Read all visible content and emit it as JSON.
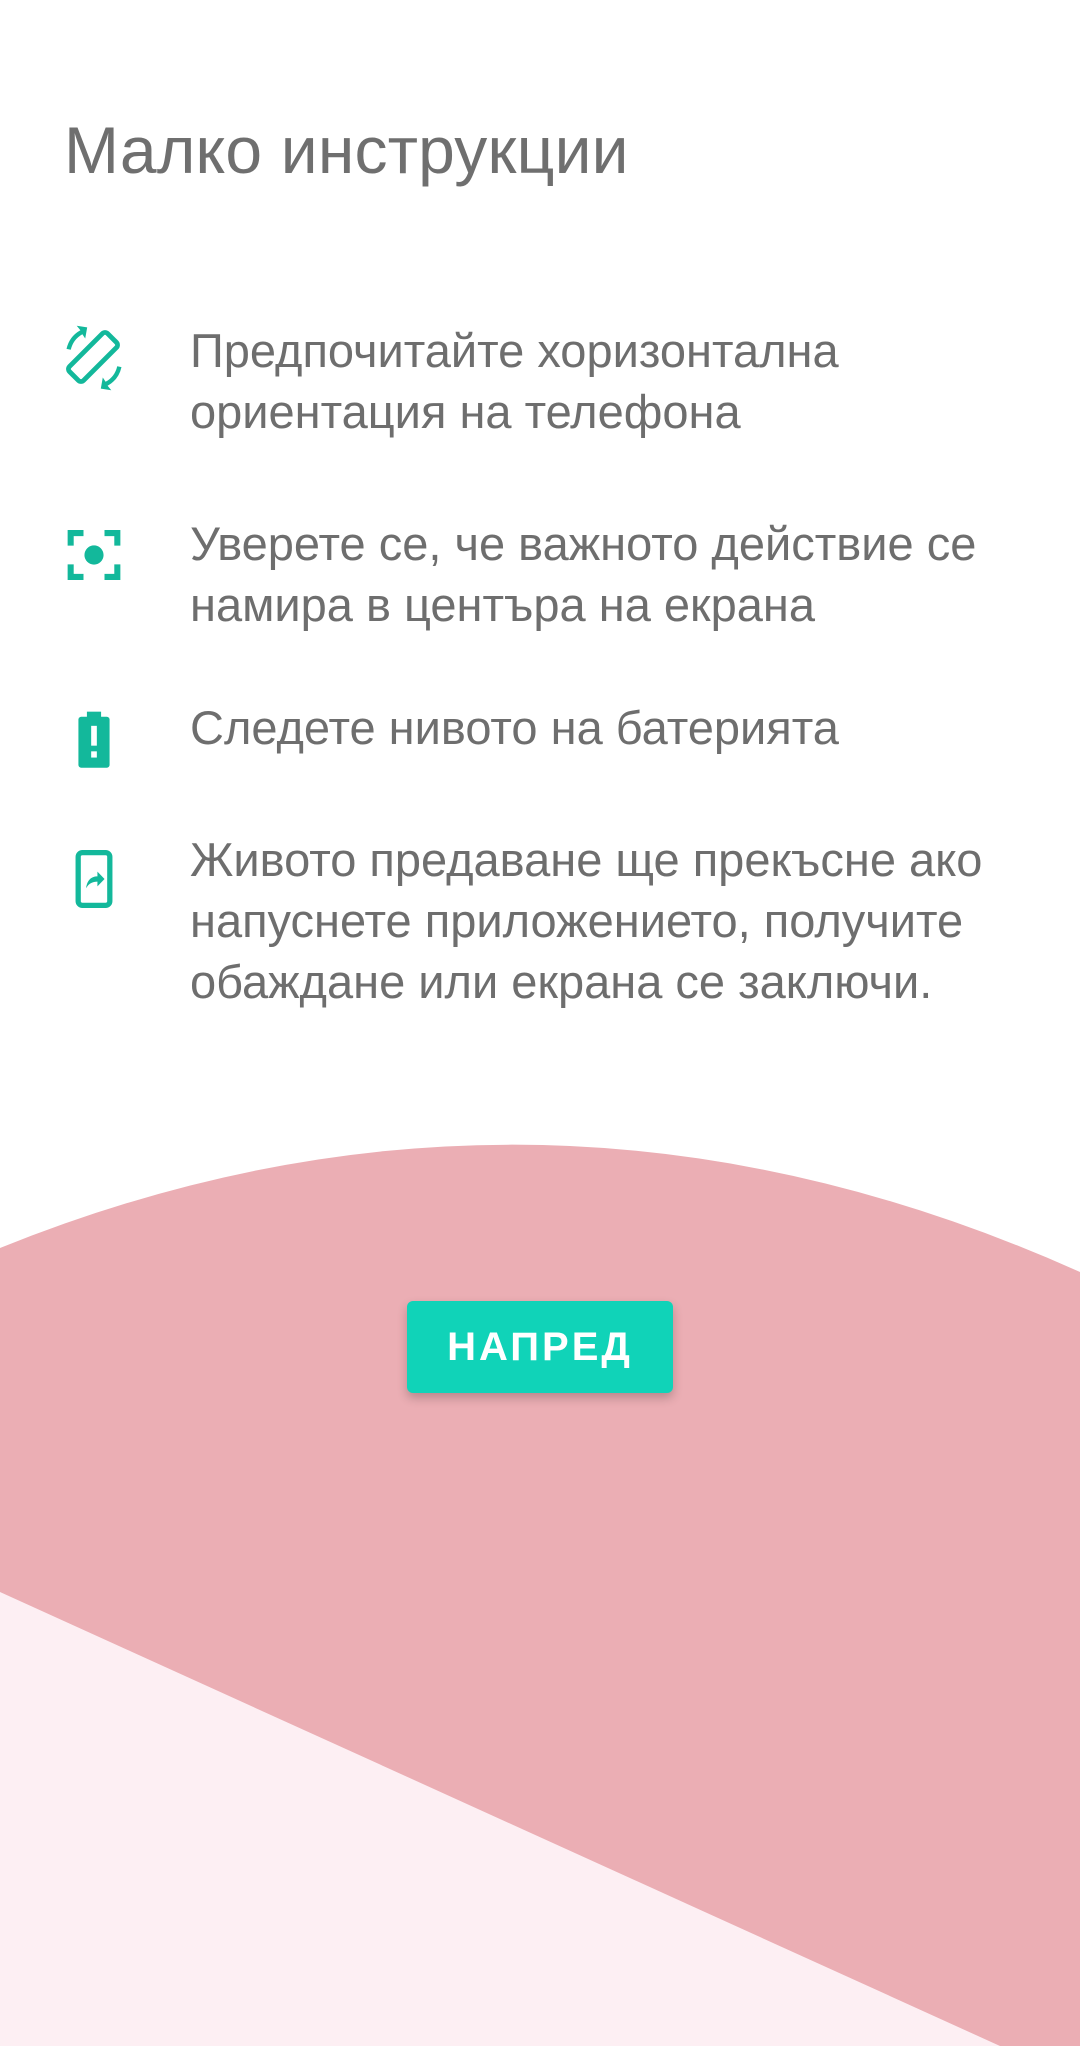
{
  "title": "Малко инструкции",
  "instructions": [
    {
      "icon": "screen-rotation-icon",
      "text": "Предпочитайте хоризонтална ориентация на телефона"
    },
    {
      "icon": "center-focus-icon",
      "text": "Уверете се, че важното действие се намира в центъра на екрана"
    },
    {
      "icon": "battery-alert-icon",
      "text": "Следете нивото на батерията"
    },
    {
      "icon": "screen-share-icon",
      "text": "Живото предаване ще прекъсне ако напуснете приложението, получите обаждане или екрана се заключи."
    }
  ],
  "next_button": {
    "label": "НАПРЕД"
  },
  "colors": {
    "accent": "#10d3b8",
    "text": "#6e6e6e",
    "wave_pink": "#ebaeb4",
    "corner_pink": "#fdeff3",
    "background": "#ffffff"
  }
}
